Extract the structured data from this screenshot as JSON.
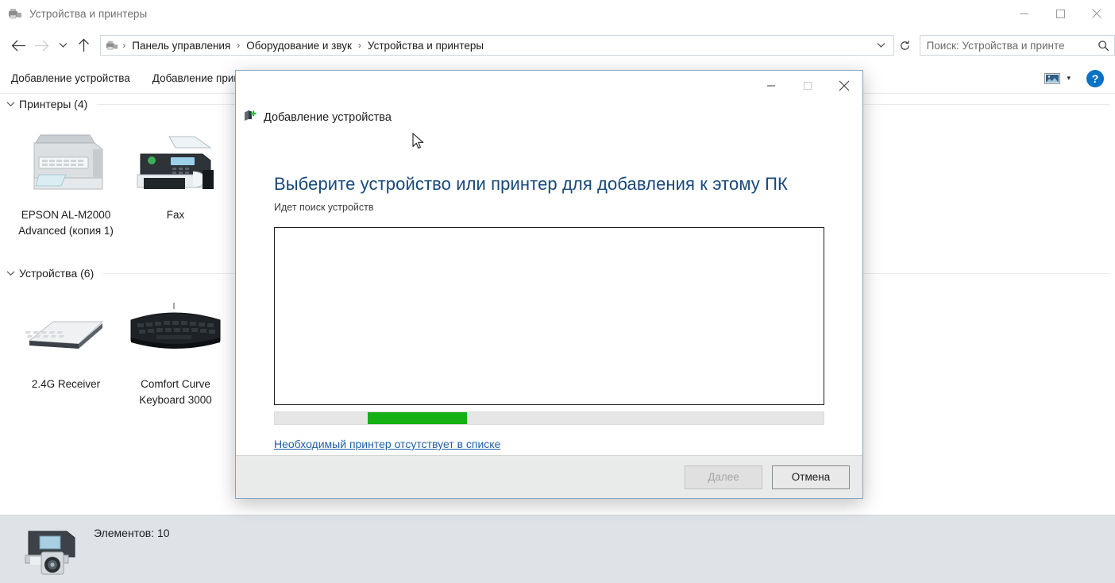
{
  "window": {
    "title": "Устройства и принтеры",
    "title_icon": "devices-printers-icon",
    "minimize_label": "Свернуть",
    "maximize_label": "Развернуть",
    "close_label": "Закрыть"
  },
  "nav": {
    "back_icon": "arrow-left-icon",
    "forward_icon": "arrow-right-icon",
    "recent_icon": "chevron-down-icon",
    "up_icon": "arrow-up-icon",
    "refresh_icon": "refresh-icon",
    "breadcrumb_icon": "devices-printers-icon",
    "crumbs": [
      "Панель управления",
      "Оборудование и звук",
      "Устройства и принтеры"
    ],
    "separator": "›"
  },
  "search": {
    "placeholder": "Поиск: Устройства и принте",
    "value": "",
    "icon": "search-icon"
  },
  "command_bar": {
    "items": [
      "Добавление устройства",
      "Добавление принтера"
    ],
    "view_icon": "view-layout-icon",
    "view_caret": "▾",
    "help_label": "?"
  },
  "content": {
    "groups": [
      {
        "label": "Принтеры (4)",
        "chevron": "⌄",
        "tiles": [
          {
            "label": "EPSON AL-M2000 Advanced (копия 1)",
            "icon": "multifunction-printer-icon"
          },
          {
            "label": "Fax",
            "icon": "fax-icon"
          }
        ]
      },
      {
        "label": "Устройства (6)",
        "chevron": "⌄",
        "tiles": [
          {
            "label": "2.4G Receiver",
            "icon": "keyboard-white-icon"
          },
          {
            "label": "Comfort Curve Keyboard 3000",
            "icon": "keyboard-black-icon"
          }
        ]
      }
    ]
  },
  "status_bar": {
    "text": "Элементов: 10",
    "icon": "device-camera-printer-icon"
  },
  "dialog": {
    "caption": "Добавление устройства",
    "caption_icon": "add-device-icon",
    "minimize_label": "Свернуть",
    "maximize_label": "Развернуть",
    "close_label": "Закрыть",
    "heading": "Выберите устройство или принтер для добавления к этому ПК",
    "subtitle": "Идет поиск устройств",
    "list_items": [],
    "progress": {
      "indeterminate": true,
      "chunk_start_pct": 17,
      "chunk_width_pct": 18,
      "color": "#14b014"
    },
    "link": "Необходимый принтер отсутствует в списке",
    "buttons": {
      "next": "Далее",
      "next_disabled": true,
      "cancel": "Отмена"
    }
  },
  "cursor": {
    "icon": "mouse-pointer-icon"
  },
  "colors": {
    "accent": "#17487a",
    "link": "#1f5fa8",
    "progress_green": "#14b014",
    "help_blue": "#0a72c4",
    "dialog_border": "#7ea6c4"
  }
}
